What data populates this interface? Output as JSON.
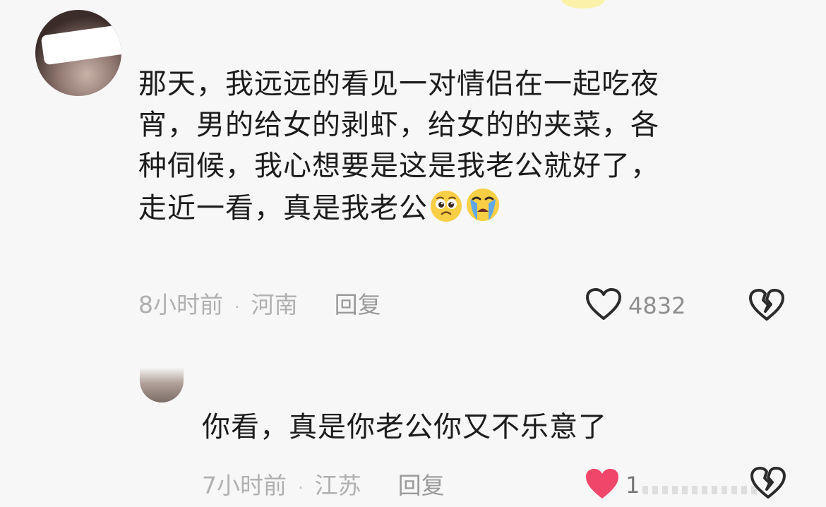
{
  "comment": {
    "username": "",
    "text": "那天，我远远的看见一对情侣在一起吃夜宵，男的给女的剥虾，给女的的夹菜，各种伺候，我心想要是这是我老公就好了，走近一看，真是我老公",
    "lines": [
      "那天，我远远的看见一对情侣在一起吃夜",
      "宵，男的给女的剥虾，给女的的夹菜，各",
      "种伺候，我心想要是这是我老公就好了，",
      "走近一看，真是我老公"
    ],
    "emojis": [
      "pleading-face",
      "crying-face"
    ],
    "time": "8小时前",
    "dot": "·",
    "location": "河南",
    "reply_label": "回复",
    "likes": "4832",
    "liked": false
  },
  "reply": {
    "username": "",
    "text": "你看，真是你老公你又不乐意了",
    "time": "7小时前",
    "dot": "·",
    "location": "江苏",
    "reply_label": "回复",
    "likes": "1",
    "liked": true
  },
  "colors": {
    "background": "#f7f7f7",
    "text": "#1c1c1c",
    "meta": "#b0b0b0",
    "heart_outline": "#2b2b2b",
    "liked_heart": "#f0466a",
    "emoji_yellow": "#f7cf45",
    "emoji_tear": "#62a8e8"
  }
}
